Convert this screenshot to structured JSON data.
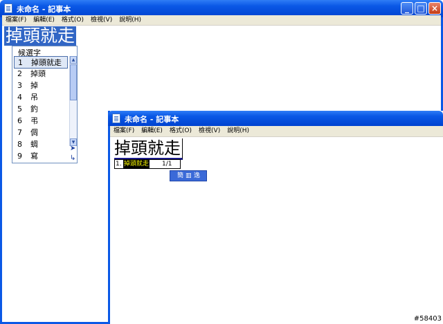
{
  "window1": {
    "title": "未命名 - 記事本",
    "menu": [
      "檔案(F)",
      "編輯(E)",
      "格式(O)",
      "檢視(V)",
      "說明(H)"
    ],
    "text": "掉頭就走",
    "controls": {
      "minimize": "_",
      "maximize": "□",
      "close": "×"
    }
  },
  "candidates": {
    "title": "候選字",
    "items": [
      {
        "num": "1",
        "word": "掉頭就走"
      },
      {
        "num": "2",
        "word": "掉頭"
      },
      {
        "num": "3",
        "word": "掉"
      },
      {
        "num": "4",
        "word": "吊"
      },
      {
        "num": "5",
        "word": "釣"
      },
      {
        "num": "6",
        "word": "弔"
      },
      {
        "num": "7",
        "word": "倜"
      },
      {
        "num": "8",
        "word": "蜩"
      },
      {
        "num": "9",
        "word": "寫"
      }
    ],
    "selected_index": 0
  },
  "window2": {
    "title": "未命名 - 記事本",
    "menu": [
      "檔案(F)",
      "編輯(E)",
      "格式(O)",
      "檢視(V)",
      "說明(H)"
    ],
    "text": "掉頭就走",
    "composition_num": "1.",
    "composition_word": "掉頭就走",
    "composition_page": "1/1",
    "ime_bar": [
      "簡",
      "▥",
      "逸"
    ]
  },
  "watermark": "#58403",
  "colors": {
    "titlebar": "#0a58e6",
    "menubar": "#ece9d8",
    "highlight": "#3166c5"
  }
}
